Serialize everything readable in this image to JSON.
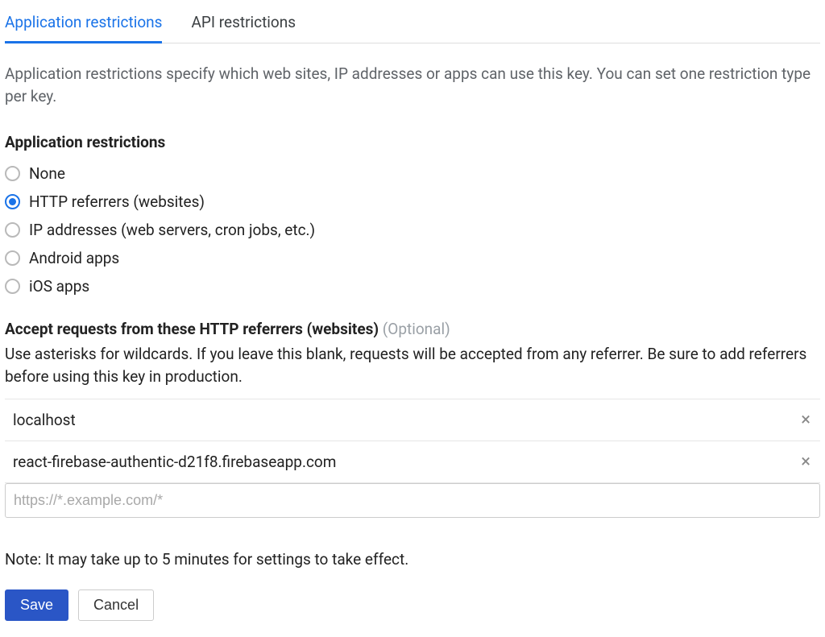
{
  "tabs": {
    "application_restrictions": "Application restrictions",
    "api_restrictions": "API restrictions"
  },
  "description": "Application restrictions specify which web sites, IP addresses or apps can use this key. You can set one restriction type per key.",
  "section_title": "Application restrictions",
  "radios": {
    "none": "None",
    "http_referrers": "HTTP referrers (websites)",
    "ip_addresses": "IP addresses (web servers, cron jobs, etc.)",
    "android_apps": "Android apps",
    "ios_apps": "iOS apps",
    "selected": "http_referrers"
  },
  "accept": {
    "title_bold": "Accept requests from these HTTP referrers (websites)",
    "title_optional": "(Optional)",
    "description": "Use asterisks for wildcards. If you leave this blank, requests will be accepted from any referrer. Be sure to add referrers before using this key in production."
  },
  "referrers": {
    "items": [
      {
        "value": "localhost"
      },
      {
        "value": "react-firebase-authentic-d21f8.firebaseapp.com"
      }
    ],
    "input_placeholder": "https://*.example.com/*"
  },
  "note": "Note: It may take up to 5 minutes for settings to take effect.",
  "buttons": {
    "save": "Save",
    "cancel": "Cancel"
  }
}
